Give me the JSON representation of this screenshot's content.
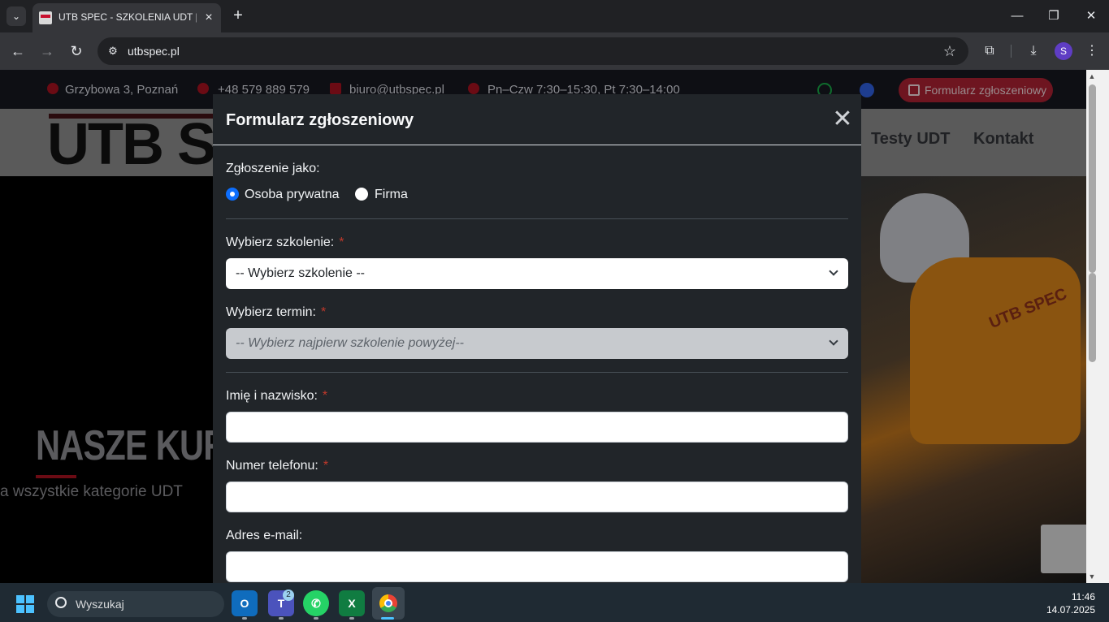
{
  "browser": {
    "tab_title": "UTB SPEC - SZKOLENIA UDT | W",
    "url": "utbspec.pl",
    "profile_initial": "S"
  },
  "site": {
    "topbar": {
      "address": "Grzybowa 3, Poznań",
      "phone": "+48 579 889 579",
      "email": "biuro@utbspec.pl",
      "hours": "Pn–Czw 7:30–15:30, Pt 7:30–14:00",
      "form_button": "Formularz zgłoszeniowy"
    },
    "logo": "UTB S",
    "nav": {
      "testy": "Testy UDT",
      "kontakt": "Kontakt"
    },
    "hero": {
      "title": "NASZE KURSY",
      "subtitle": "a wszystkie kategorie UDT",
      "jacket_text": "UTB SPEC"
    }
  },
  "modal": {
    "title": "Formularz zgłoszeniowy",
    "close_symbol": "✕",
    "applicant_label": "Zgłoszenie jako:",
    "applicant_options": [
      "Osoba prywatna",
      "Firma"
    ],
    "applicant_selected": "Osoba prywatna",
    "training_label": "Wybierz szkolenie:",
    "training_value": "-- Wybierz szkolenie --",
    "term_label": "Wybierz termin:",
    "term_value": "-- Wybierz najpierw szkolenie powyżej--",
    "name_label": "Imię i nazwisko:",
    "phone_label": "Numer telefonu:",
    "email_label": "Adres e-mail:",
    "required_mark": "*"
  },
  "taskbar": {
    "search_placeholder": "Wyszukaj",
    "teams_badge": "2",
    "time": "11:46",
    "date": "14.07.2025"
  },
  "colors": {
    "modal_bg": "#212529",
    "accent_red": "#c8102e",
    "radio_blue": "#0d6efd"
  }
}
